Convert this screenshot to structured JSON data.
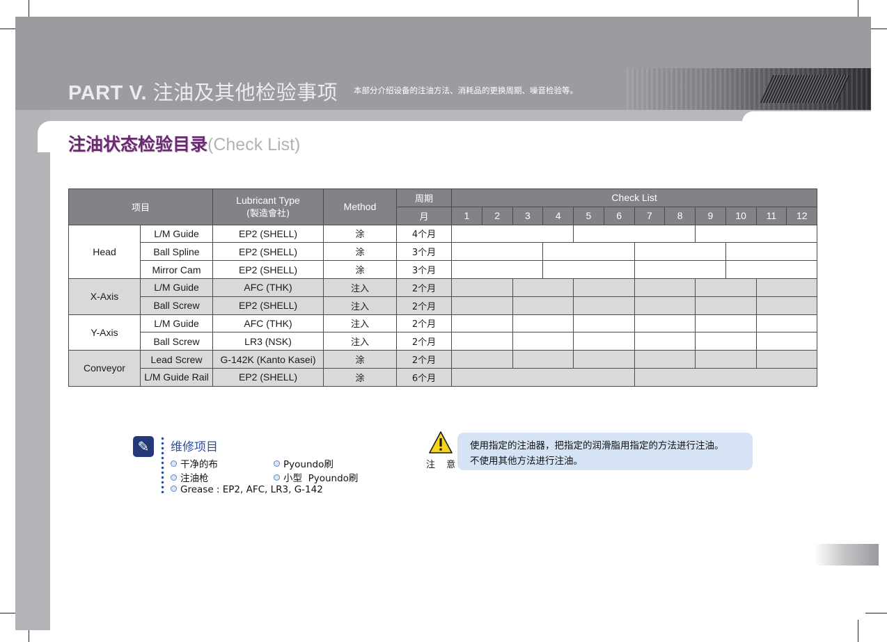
{
  "header": {
    "part_label": "PART V.",
    "part_title": "注油及其他检验事项",
    "description": "本部分介绍设备的注油方法、消耗品的更换周期、噪音检验等。"
  },
  "section": {
    "title_cn": "注油状态检验目录",
    "title_en": "(Check List)"
  },
  "table": {
    "headers": {
      "item": "项目",
      "lubricant_type": "Lubricant Type",
      "lubricant_type_sub": "(製造會社)",
      "method": "Method",
      "period": "周期",
      "period_unit": "月",
      "check_list": "Check List",
      "months": [
        "1",
        "2",
        "3",
        "4",
        "5",
        "6",
        "7",
        "8",
        "9",
        "10",
        "11",
        "12"
      ]
    },
    "groups": [
      {
        "name": "Head",
        "rows": [
          {
            "part": "L/M Guide",
            "lubricant": "EP2 (SHELL)",
            "method": "涂",
            "period": "4个月"
          },
          {
            "part": "Ball Spline",
            "lubricant": "EP2 (SHELL)",
            "method": "涂",
            "period": "3个月"
          },
          {
            "part": "Mirror Cam",
            "lubricant": "EP2 (SHELL)",
            "method": "涂",
            "period": "3个月"
          }
        ]
      },
      {
        "name": "X-Axis",
        "rows": [
          {
            "part": "L/M Guide",
            "lubricant": "AFC (THK)",
            "method": "注入",
            "period": "2个月"
          },
          {
            "part": "Ball Screw",
            "lubricant": "EP2 (SHELL)",
            "method": "注入",
            "period": "2个月"
          }
        ]
      },
      {
        "name": "Y-Axis",
        "rows": [
          {
            "part": "L/M Guide",
            "lubricant": "AFC (THK)",
            "method": "注入",
            "period": "2个月"
          },
          {
            "part": "Ball Screw",
            "lubricant": "LR3 (NSK)",
            "method": "注入",
            "period": "2个月"
          }
        ]
      },
      {
        "name": "Conveyor",
        "rows": [
          {
            "part": "Lead Screw",
            "lubricant": "G-142K (Kanto Kasei)",
            "method": "涂",
            "period": "2个月"
          },
          {
            "part": "L/M Guide Rail",
            "lubricant": "EP2 (SHELL)",
            "method": "涂",
            "period": "6个月"
          }
        ]
      }
    ]
  },
  "maintenance": {
    "icon": "wrench-icon",
    "title": "维修项目",
    "items": [
      "干净的布",
      "Pyoundo刷",
      "注油枪",
      "小型  Pyoundo刷",
      "Grease : EP2, AFC, LR3, G-142"
    ]
  },
  "caution": {
    "icon": "warning-icon",
    "label": "注 意",
    "lines": [
      "使用指定的注油器，把指定的润滑脂用指定的方法进行注油。",
      "不使用其他方法进行注油。"
    ]
  }
}
